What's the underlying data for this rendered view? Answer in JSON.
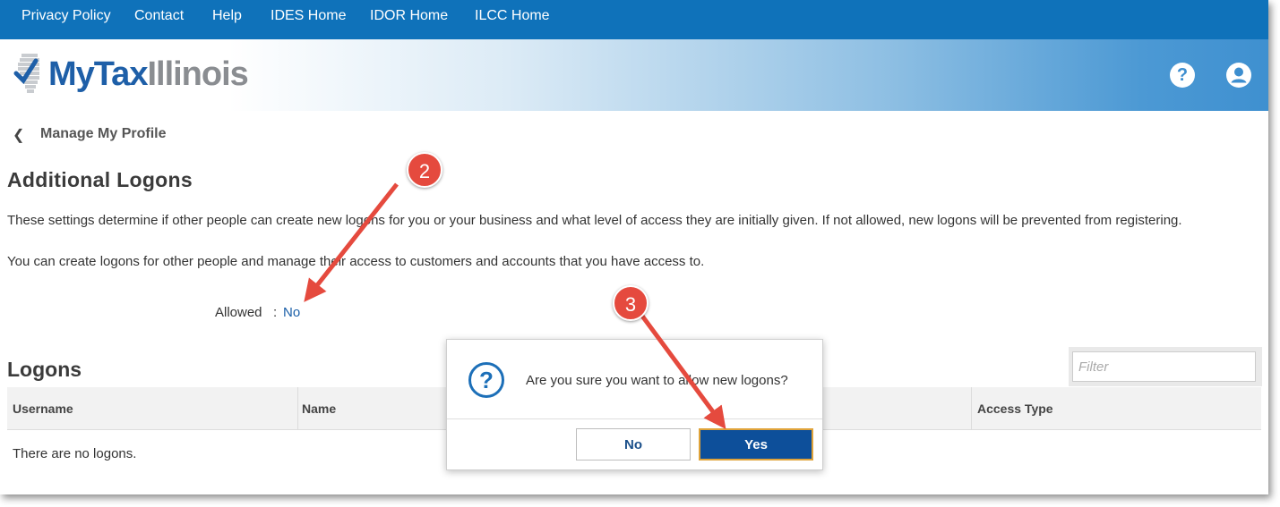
{
  "topnav": {
    "links": [
      {
        "label": "Privacy Policy"
      },
      {
        "label": "Contact"
      },
      {
        "label": "Help"
      },
      {
        "label": "IDES Home"
      },
      {
        "label": "IDOR Home"
      },
      {
        "label": "ILCC Home"
      }
    ]
  },
  "header": {
    "logo_part1": "MyTax",
    "logo_part2": "Illinois",
    "help_icon": "question-circle-icon",
    "account_icon": "user-circle-icon"
  },
  "breadcrumb": {
    "back_icon": "chevron-left-icon",
    "label": "Manage My Profile"
  },
  "additional_logons": {
    "title": "Additional Logons",
    "paragraph1": "These settings determine if other people can create new logons for you or your business and what level of access they are initially given. If not allowed, new logons will be prevented from registering.",
    "paragraph2": "You can create logons for other people and manage their access to customers and accounts that you have access to.",
    "allowed_label": "Allowed",
    "allowed_separator": ":",
    "allowed_value": "No"
  },
  "logons": {
    "title": "Logons",
    "filter_placeholder": "Filter",
    "columns": [
      "Username",
      "Name",
      "Access Type"
    ],
    "empty_message": "There are no logons."
  },
  "dialog": {
    "icon": "question-circle-icon",
    "message": "Are you sure you want to allow new logons?",
    "no_label": "No",
    "yes_label": "Yes"
  },
  "annotations": {
    "step2": "2",
    "step3": "3",
    "color": "#e54a3e"
  },
  "colors": {
    "nav_bg": "#0f72ba",
    "link": "#1a5fa8",
    "primary_button": "#0d4f9a",
    "focus_ring": "#e0a33a"
  }
}
